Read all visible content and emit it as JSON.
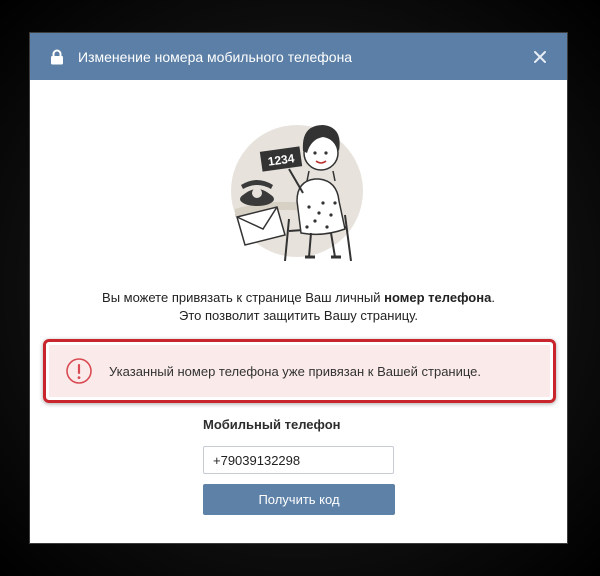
{
  "dialog": {
    "title": "Изменение номера мобильного телефона",
    "lock_icon": "lock-icon",
    "close_icon": "close-icon"
  },
  "illustration": {
    "sign_text": "1234"
  },
  "description": {
    "line1_prefix": "Вы можете привязать к странице Ваш личный ",
    "line1_bold": "номер телефона",
    "line1_suffix": ".",
    "line2": "Это позволит защитить Вашу страницу."
  },
  "alert": {
    "icon": "exclamation-circle-icon",
    "text": "Указанный номер телефона уже привязан к Вашей странице.",
    "highlight_color": "#c8252c",
    "background_color": "#fbeaea"
  },
  "form": {
    "phone_label": "Мобильный телефон",
    "phone_value": "+79039132298",
    "submit_label": "Получить код"
  },
  "colors": {
    "header": "#5b7fa6",
    "button": "#5e81a8"
  }
}
